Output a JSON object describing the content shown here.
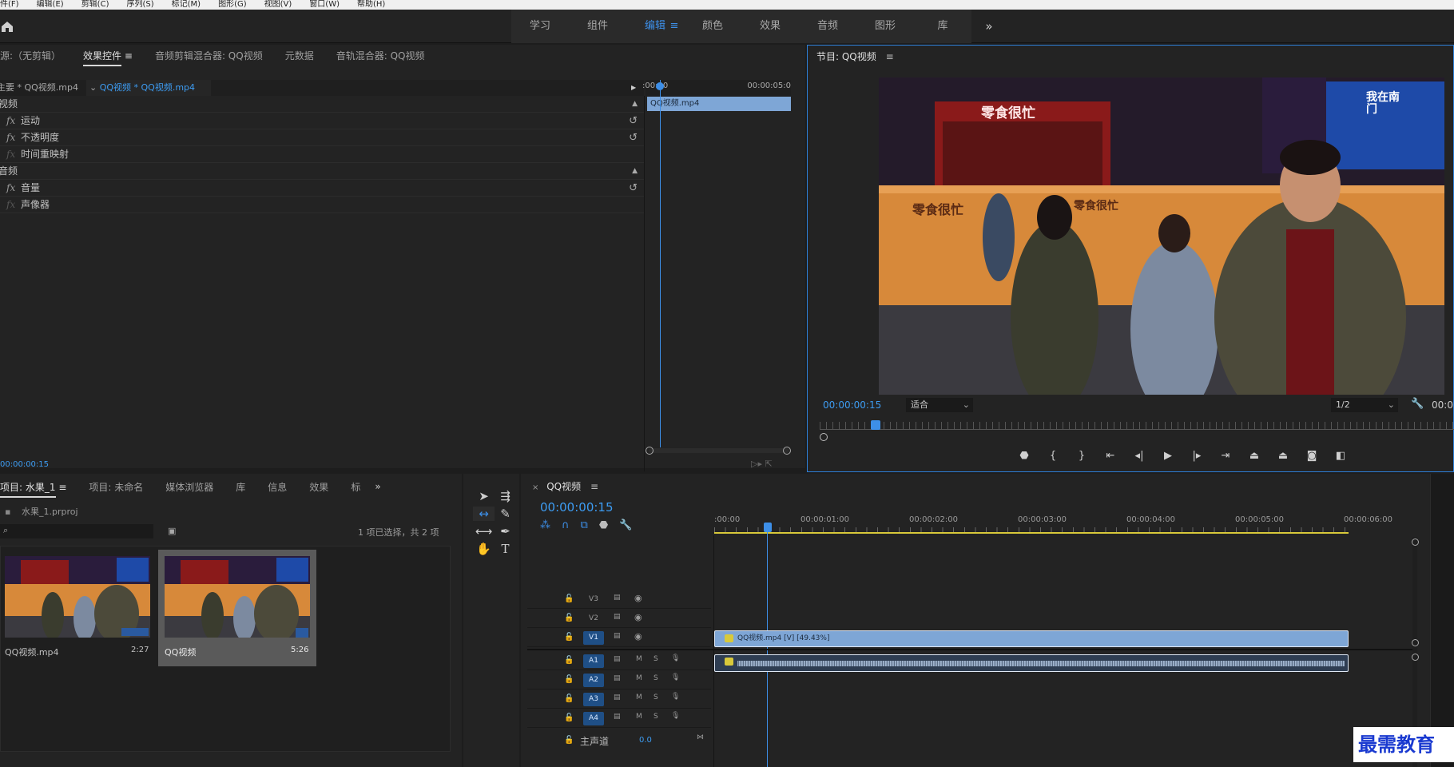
{
  "menubar": {
    "items": [
      "件(F)",
      "编辑(E)",
      "剪辑(C)",
      "序列(S)",
      "标记(M)",
      "图形(G)",
      "视图(V)",
      "窗口(W)",
      "帮助(H)"
    ]
  },
  "workspace": {
    "tabs": [
      "学习",
      "组件",
      "编辑",
      "颜色",
      "效果",
      "音频",
      "图形",
      "库"
    ],
    "active": "编辑"
  },
  "fx_panel": {
    "tabs": [
      "源:（无剪辑）",
      "效果控件",
      "音频剪辑混合器: QQ视频",
      "元数据",
      "音轨混合器: QQ视频"
    ],
    "master_clip": "主要 * QQ视频.mp4",
    "sequence_clip": "QQ视频 * QQ视频.mp4",
    "time_start": ":00:00",
    "time_end": "00:00:05:0",
    "clip_bar": "QQ视频.mp4",
    "video_header": "视频",
    "video_effects": [
      "运动",
      "不透明度",
      "时间重映射"
    ],
    "audio_header": "音频",
    "audio_effects": [
      "音量",
      "声像器"
    ],
    "timecode": "00:00:00:15"
  },
  "program": {
    "title": "节目: QQ视频",
    "timecode": "00:00:00:15",
    "fit": "适合",
    "resolution": "1/2",
    "time_right": "00:0",
    "video_sign_1": "零食很忙",
    "video_sign_2": "零食很忙",
    "video_sign_3": "零食很忙",
    "video_screen_text": "我在南门"
  },
  "project": {
    "tabs": [
      "项目: 水果_1",
      "项目: 未命名",
      "媒体浏览器",
      "库",
      "信息",
      "效果",
      "标"
    ],
    "file": "水果_1.prproj",
    "selection": "1 项已选择，共 2 项",
    "items": [
      {
        "name": "QQ视频.mp4",
        "duration": "2:27"
      },
      {
        "name": "QQ视频",
        "duration": "5:26"
      }
    ]
  },
  "timeline": {
    "title": "QQ视频",
    "timecode": "00:00:00:15",
    "ruler": [
      ":00:00",
      "00:00:01:00",
      "00:00:02:00",
      "00:00:03:00",
      "00:00:04:00",
      "00:00:05:00",
      "00:00:06:00"
    ],
    "video_tracks": [
      "V3",
      "V2",
      "V1"
    ],
    "audio_tracks": [
      "A1",
      "A2",
      "A3",
      "A4"
    ],
    "clip_label": "QQ视频.mp4 [V] [49.43%]",
    "master_label": "主声道",
    "master_value": "0.0"
  },
  "watermark": "最需教育",
  "colors": {
    "accent": "#3d8fe8",
    "clip_video": "#7ea6d6",
    "track_active": "#1f4f86",
    "work_area": "#d8c93a"
  }
}
